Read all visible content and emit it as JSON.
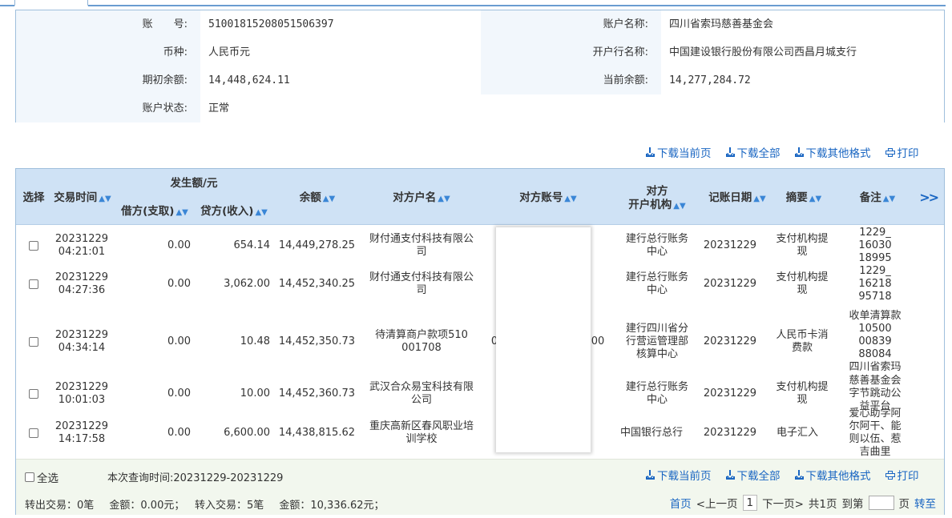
{
  "account_info": {
    "account_no_label": "账　　号:",
    "account_no": "51001815208051506397",
    "account_name_label": "账户名称:",
    "account_name": "四川省索玛慈善基金会",
    "currency_label": "币种:",
    "currency": "人民币元",
    "bank_label": "开户行名称:",
    "bank": "中国建设银行股份有限公司西昌月城支行",
    "opening_balance_label": "期初余额:",
    "opening_balance": "14,448,624.11",
    "current_balance_label": "当前余额:",
    "current_balance": "14,277,284.72",
    "status_label": "账户状态:",
    "status": "正常"
  },
  "actions": {
    "download_page": "下载当前页",
    "download_all": "下载全部",
    "download_other": "下载其他格式",
    "print": "打印"
  },
  "table": {
    "headers": {
      "select": "选择",
      "time": "交易时间",
      "amount_group": "发生额/元",
      "debit": "借方(支取)",
      "credit": "贷方(收入)",
      "balance": "余额",
      "counterparty_name": "对方户名",
      "counterparty_account": "对方账号",
      "counterparty_bank_1": "对方",
      "counterparty_bank_2": "开户机构",
      "post_date": "记账日期",
      "summary": "摘要",
      "remark": "备注",
      "more": ">>"
    },
    "rows": [
      {
        "time_date": "20231229",
        "time_clock": "04:21:01",
        "debit": "0.00",
        "credit": "654.14",
        "balance": "14,449,278.25",
        "name_1": "财付通支付科技有限公",
        "name_2": "司",
        "account": "",
        "bank_1": "建行总行账务",
        "bank_2": "中心",
        "bank_3": "",
        "post_date": "20231229",
        "summary_1": "支付机构提",
        "summary_2": "现",
        "remark_1": "1229_",
        "remark_2": "16030",
        "remark_3": "18995",
        "remark_4": "",
        "remark_5": ""
      },
      {
        "time_date": "20231229",
        "time_clock": "04:27:36",
        "debit": "0.00",
        "credit": "3,062.00",
        "balance": "14,452,340.25",
        "name_1": "财付通支付科技有限公",
        "name_2": "司",
        "account": "",
        "bank_1": "建行总行账务",
        "bank_2": "中心",
        "bank_3": "",
        "post_date": "20231229",
        "summary_1": "支付机构提",
        "summary_2": "现",
        "remark_1": "1229_",
        "remark_2": "16218",
        "remark_3": "95718",
        "remark_4": "",
        "remark_5": ""
      },
      {
        "time_date": "20231229",
        "time_clock": "04:34:14",
        "debit": "0.00",
        "credit": "10.48",
        "balance": "14,452,350.73",
        "name_1": "待清算商户款项510",
        "name_2": "001708",
        "account": "0",
        "account_tail": "00",
        "bank_1": "建行四川省分",
        "bank_2": "行营运管理部",
        "bank_3": "核算中心",
        "post_date": "20231229",
        "summary_1": "人民币卡消",
        "summary_2": "费款",
        "remark_1": "收单清算款",
        "remark_2": "10500",
        "remark_3": "00839",
        "remark_4": "88084",
        "remark_5": "四川省索玛"
      },
      {
        "time_date": "20231229",
        "time_clock": "10:01:03",
        "debit": "0.00",
        "credit": "10.00",
        "balance": "14,452,360.73",
        "name_1": "武汉合众易宝科技有限",
        "name_2": "公司",
        "account": "",
        "bank_1": "建行总行账务",
        "bank_2": "中心",
        "bank_3": "",
        "post_date": "20231229",
        "summary_1": "支付机构提",
        "summary_2": "现",
        "remark_1": "慈善基金会",
        "remark_2": "字节跳动公",
        "remark_3": "益平台",
        "remark_4": "",
        "remark_5": ""
      },
      {
        "time_date": "20231229",
        "time_clock": "14:17:58",
        "debit": "0.00",
        "credit": "6,600.00",
        "balance": "14,438,815.62",
        "name_1": "重庆高新区春风职业培",
        "name_2": "训学校",
        "account": "",
        "bank_1": "中国银行总行",
        "bank_2": "",
        "bank_3": "",
        "post_date": "20231229",
        "summary_1": "电子汇入",
        "summary_2": "",
        "remark_1": "爱心助学阿",
        "remark_2": "尔阿干、能",
        "remark_3": "则以伍、惹",
        "remark_4": "吉曲里",
        "remark_5": ""
      }
    ]
  },
  "footer": {
    "select_all": "全选",
    "query_time": "本次查询时间:20231229-20231229",
    "summary": "转出交易：0笔　 金额：0.00元；　 转入交易：5笔　 金额：10,336.62元；",
    "first": "首页",
    "prev": "<上一页",
    "current_page": "1",
    "next": "下一页>",
    "total": "共1页",
    "goto_label": "到第",
    "page_unit": "页",
    "goto": "转至"
  }
}
